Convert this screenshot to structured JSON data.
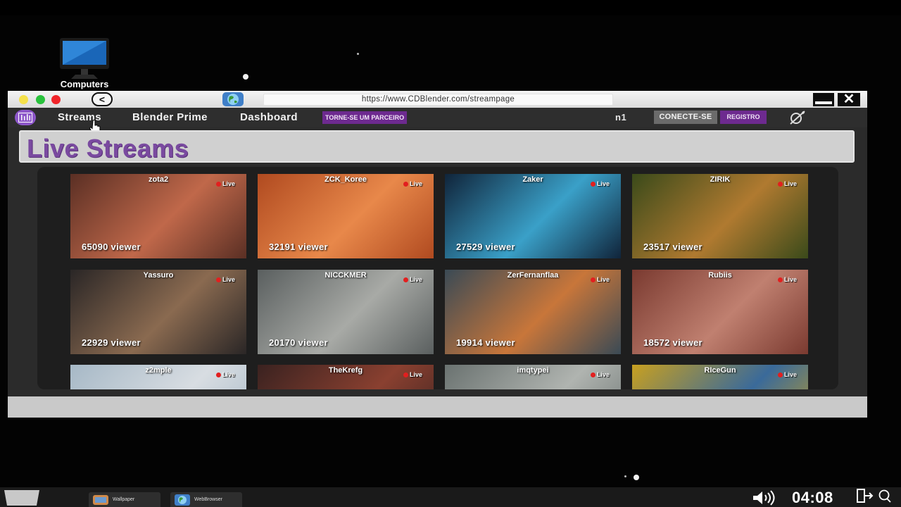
{
  "desktop": {
    "icon_label": "Computers"
  },
  "browser": {
    "url": "https://www.CDBlender.com/streampage",
    "close_label": "✕",
    "back_label": "<"
  },
  "nav": {
    "links": [
      "Streams",
      "Blender Prime",
      "Dashboard"
    ],
    "partner_badge": "TORNE-SE UM PARCEIRO",
    "user": "n1",
    "connect": "CONECTE-SE",
    "register": "REGISTRO"
  },
  "page": {
    "title": "Live Streams"
  },
  "streams": [
    {
      "name": "zota2",
      "live": "Live",
      "viewers": "65090 viewer"
    },
    {
      "name": "ZCK_Koree",
      "live": "Live",
      "viewers": "32191 viewer"
    },
    {
      "name": "Zaker",
      "live": "Live",
      "viewers": "27529 viewer"
    },
    {
      "name": "ZIRIK",
      "live": "Live",
      "viewers": "23517 viewer"
    },
    {
      "name": "Yassuro",
      "live": "Live",
      "viewers": "22929 viewer"
    },
    {
      "name": "NICCKMER",
      "live": "Live",
      "viewers": "20170 viewer"
    },
    {
      "name": "ZerFernanflaa",
      "live": "Live",
      "viewers": "19914 viewer"
    },
    {
      "name": "Rubiis",
      "live": "Live",
      "viewers": "18572 viewer"
    },
    {
      "name": "z2mple",
      "live": "Live",
      "viewers": ""
    },
    {
      "name": "TheKrefg",
      "live": "Live",
      "viewers": ""
    },
    {
      "name": "imqtypei",
      "live": "Live",
      "viewers": ""
    },
    {
      "name": "RIceGun",
      "live": "Live",
      "viewers": ""
    }
  ],
  "thumb_colors": [
    [
      "#5a2f24",
      "#c0684a"
    ],
    [
      "#b04a20",
      "#e8884a"
    ],
    [
      "#10243a",
      "#3aa0c8"
    ],
    [
      "#3a4a1a",
      "#b07a30"
    ],
    [
      "#2a2626",
      "#8a6a50"
    ],
    [
      "#5a5f5f",
      "#a8aaa6"
    ],
    [
      "#3a4a55",
      "#c8763a"
    ],
    [
      "#7a3a30",
      "#c08070"
    ],
    [
      "#a6b8c6",
      "#d8dde2"
    ],
    [
      "#3a2220",
      "#8a4030"
    ],
    [
      "#6a7270",
      "#b0b4b0"
    ],
    [
      "#c8a020",
      "#3a6a9a"
    ]
  ],
  "taskbar": {
    "items": [
      "Wallpaper",
      "WebBrowser"
    ],
    "clock": "04:08"
  },
  "icons": [
    "computer-icon",
    "back-icon",
    "globe-icon",
    "minimize-icon",
    "close-icon",
    "equalizer-logo-icon",
    "theme-toggle-icon",
    "hand-cursor-icon",
    "volume-icon",
    "exit-icon",
    "search-icon"
  ]
}
